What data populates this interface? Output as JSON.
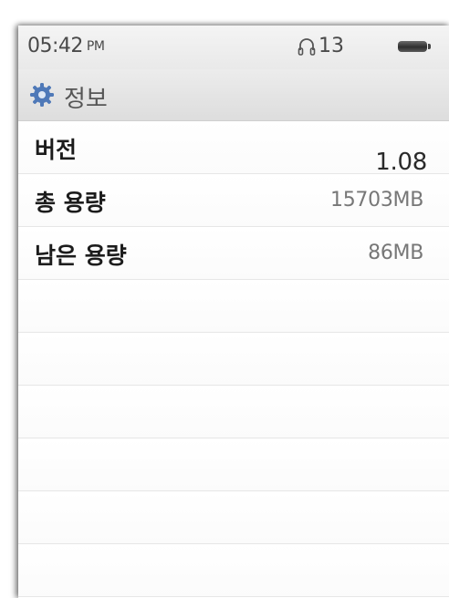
{
  "status": {
    "time": "05:42",
    "ampm": "PM",
    "audio_count": "13",
    "audio_icon": "headphones-icon",
    "battery_icon": "battery-icon"
  },
  "header": {
    "icon": "gear-icon",
    "title": "정보",
    "icon_color": "#4f79b8"
  },
  "info_rows": [
    {
      "label": "버전",
      "value": "1.08"
    },
    {
      "label": "총 용량",
      "value": "15703MB"
    },
    {
      "label": "남은 용량",
      "value": "86MB"
    },
    {
      "label": "",
      "value": ""
    },
    {
      "label": "",
      "value": ""
    },
    {
      "label": "",
      "value": ""
    },
    {
      "label": "",
      "value": ""
    },
    {
      "label": "",
      "value": ""
    },
    {
      "label": "",
      "value": ""
    }
  ]
}
